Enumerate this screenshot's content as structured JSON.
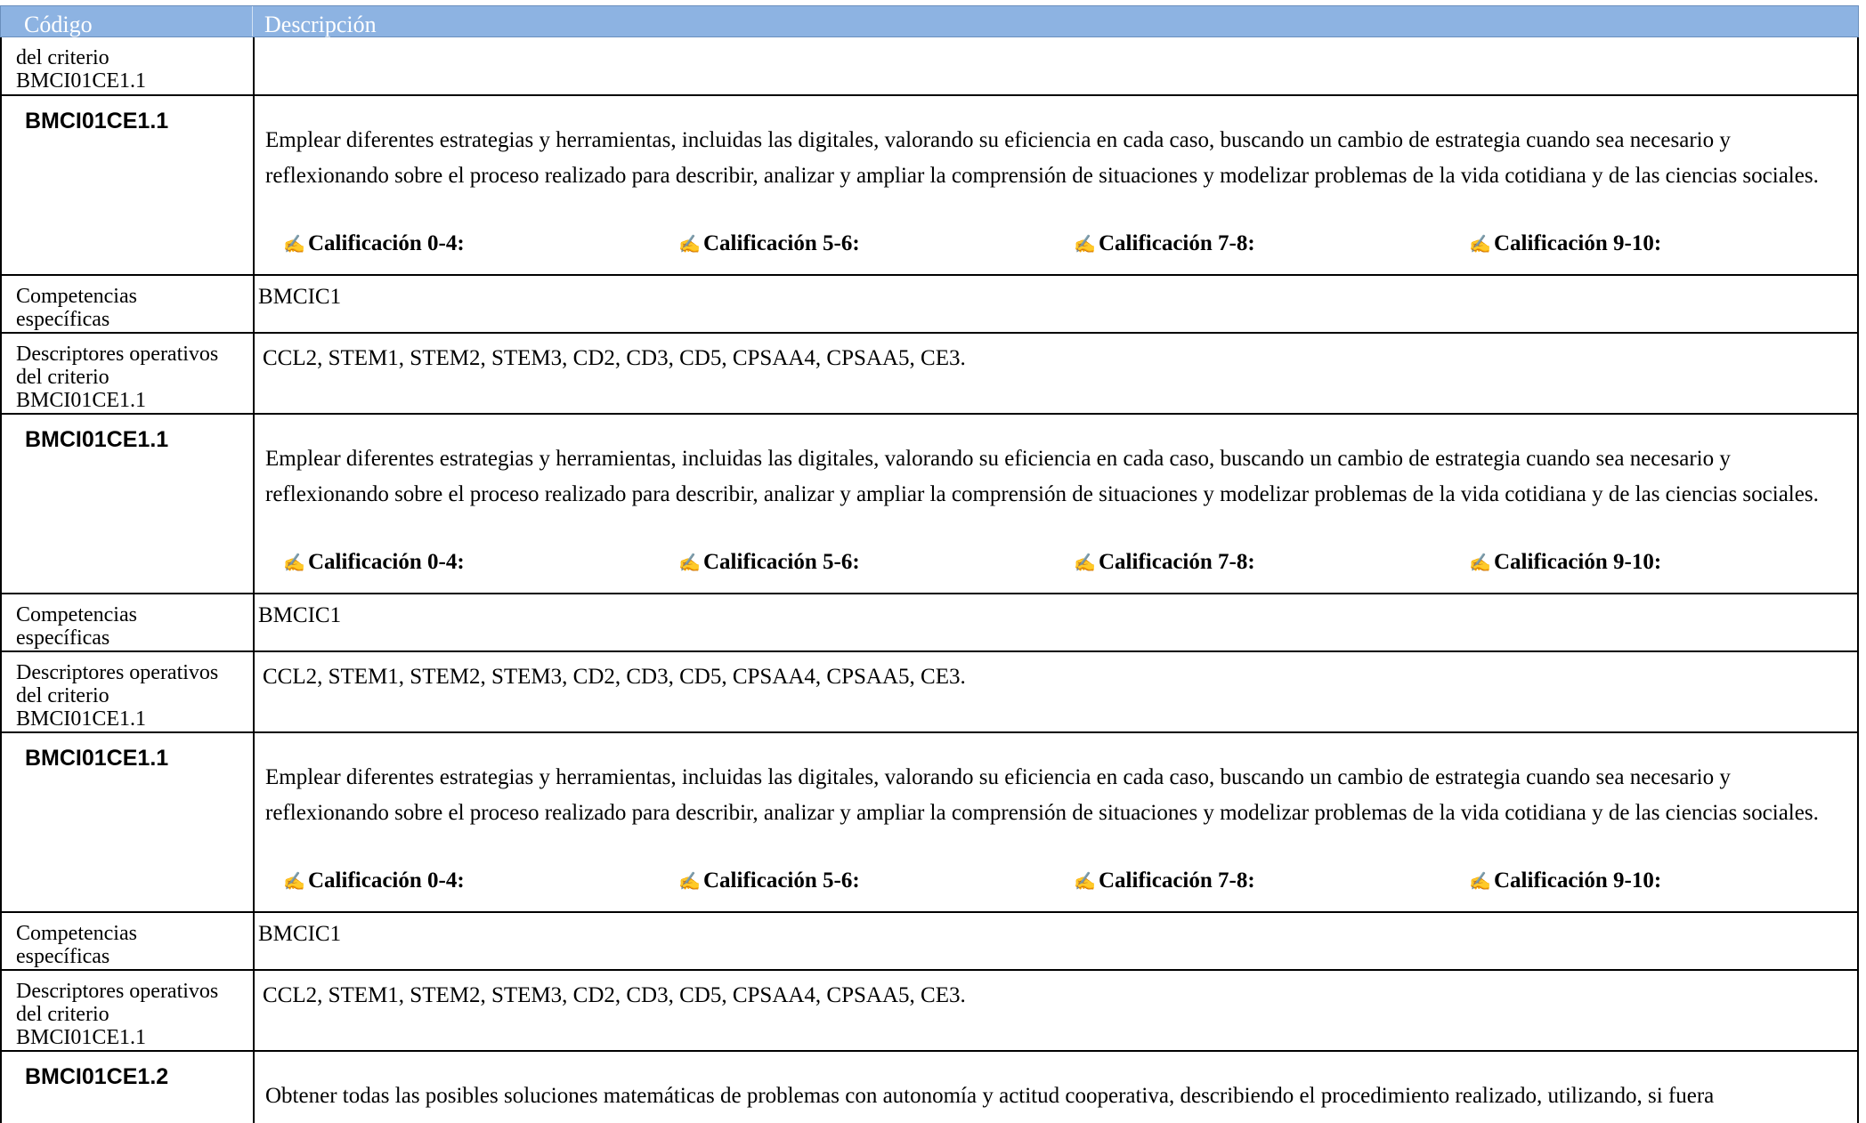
{
  "header": {
    "col1": "Código",
    "col2": "Descripción"
  },
  "top_partial": {
    "line1": "del criterio",
    "line2": "BMCI01CE1.1"
  },
  "blocks": [
    {
      "code": "BMCI01CE1.1",
      "description": "Emplear diferentes estrategias y herramientas, incluidas las digitales, valorando su eficiencia en cada caso, buscando un cambio de estrategia cuando sea necesario y reflexionando sobre el proceso realizado para describir, analizar y ampliar la comprensión de situaciones y modelizar problemas de la vida cotidiana y de las ciencias sociales.",
      "grades": [
        "Calificación 0-4:",
        "Calificación 5-6:",
        "Calificación 7-8:",
        "Calificación 9-10:"
      ],
      "comp_label_1": "Competencias",
      "comp_label_2": "específicas",
      "comp_value": "BMCIC1",
      "desc_label_1": "Descriptores operativos",
      "desc_label_2": "del criterio",
      "desc_label_3": "BMCI01CE1.1",
      "desc_value": "CCL2, STEM1, STEM2, STEM3, CD2, CD3, CD5, CPSAA4, CPSAA5, CE3."
    },
    {
      "code": "BMCI01CE1.1",
      "description": "Emplear diferentes estrategias y herramientas, incluidas las digitales, valorando su eficiencia en cada caso, buscando un cambio de estrategia cuando sea necesario y reflexionando sobre el proceso realizado para describir, analizar y ampliar la comprensión de situaciones y modelizar problemas de la vida cotidiana y de las ciencias sociales.",
      "grades": [
        "Calificación 0-4:",
        "Calificación 5-6:",
        "Calificación 7-8:",
        "Calificación 9-10:"
      ],
      "comp_label_1": "Competencias",
      "comp_label_2": "específicas",
      "comp_value": "BMCIC1",
      "desc_label_1": "Descriptores operativos",
      "desc_label_2": "del criterio",
      "desc_label_3": "BMCI01CE1.1",
      "desc_value": "CCL2, STEM1, STEM2, STEM3, CD2, CD3, CD5, CPSAA4, CPSAA5, CE3."
    },
    {
      "code": "BMCI01CE1.1",
      "description": "Emplear diferentes estrategias y herramientas, incluidas las digitales, valorando su eficiencia en cada caso, buscando un cambio de estrategia cuando sea necesario y reflexionando sobre el proceso realizado para describir, analizar y ampliar la comprensión de situaciones y modelizar problemas de la vida cotidiana y de las ciencias sociales.",
      "grades": [
        "Calificación 0-4:",
        "Calificación 5-6:",
        "Calificación 7-8:",
        "Calificación 9-10:"
      ],
      "comp_label_1": "Competencias",
      "comp_label_2": "específicas",
      "comp_value": "BMCIC1",
      "desc_label_1": "Descriptores operativos",
      "desc_label_2": "del criterio",
      "desc_label_3": "BMCI01CE1.1",
      "desc_value": "CCL2, STEM1, STEM2, STEM3, CD2, CD3, CD5, CPSAA4, CPSAA5, CE3."
    }
  ],
  "last": {
    "code": "BMCI01CE1.2",
    "description_partial": "Obtener todas las posibles soluciones matemáticas de problemas con autonomía y actitud cooperativa, describiendo el procedimiento realizado, utilizando, si fuera"
  },
  "grade_icon": "pencil-icon"
}
